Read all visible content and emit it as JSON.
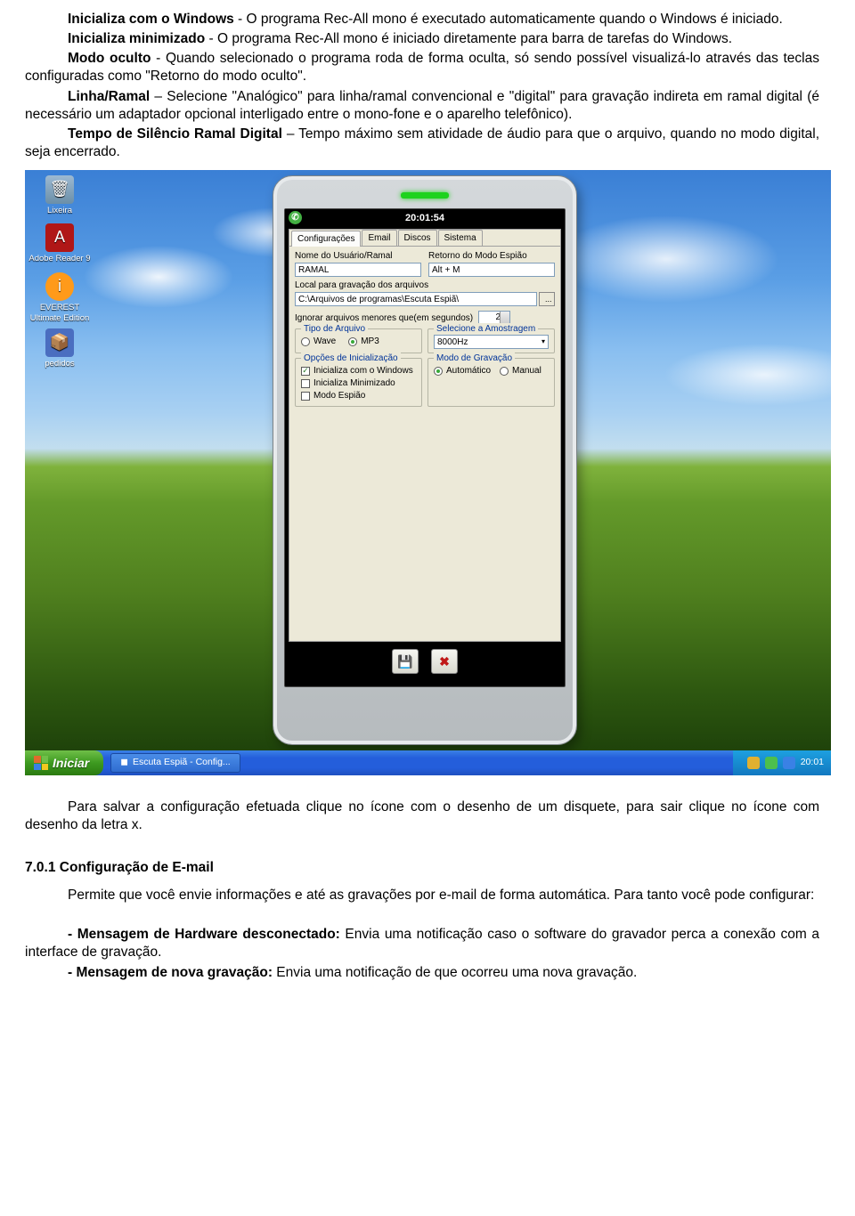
{
  "doc": {
    "p1_lead": "Inicializa com o Windows",
    "p1_rest": " - O programa Rec-All mono é executado automaticamente quando o Windows é iniciado.",
    "p2_lead": "Inicializa minimizado",
    "p2_rest": " - O programa Rec-All mono é iniciado diretamente para barra de tarefas do Windows.",
    "p3_lead": "Modo oculto",
    "p3_rest": " - Quando selecionado o programa roda de forma oculta, só sendo possível visualizá-lo através das teclas configuradas como \"Retorno do modo oculto\".",
    "p4_lead": "Linha/Ramal",
    "p4_rest": " – Selecione \"Analógico\" para linha/ramal convencional e \"digital\" para gravação indireta em ramal digital (é necessário um adaptador opcional interligado entre o mono-fone e o aparelho telefônico).",
    "p5_lead": "Tempo de Silêncio Ramal Digital",
    "p5_rest": " – Tempo máximo sem atividade de áudio para que o arquivo, quando no modo digital, seja encerrado.",
    "after1": "Para salvar a configuração efetuada clique no ícone com o desenho de um disquete, para sair clique no ícone com desenho da letra x.",
    "heading": "7.0.1 Configuração de E-mail",
    "after2": "Permite que você envie informações e até as gravações por e-mail de forma automática. Para tanto você pode configurar:",
    "li1_lead": "- Mensagem de Hardware desconectado:",
    "li1_rest": " Envia uma notificação caso o software do gravador perca a conexão com a interface de gravação.",
    "li2_lead": "- Mensagem de nova gravação:",
    "li2_rest": " Envia uma notificação de que ocorreu uma nova gravação."
  },
  "desktop": {
    "icons": {
      "bin": "Lixeira",
      "adobe": "Adobe Reader 9",
      "everest": "EVEREST Ultimate Edition",
      "pedidos": "pedidos"
    },
    "taskbar": {
      "start": "Iniciar",
      "app": "Escuta Espiã - Config...",
      "clock": "20:01"
    }
  },
  "app": {
    "clock": "20:01:54",
    "tabs": [
      "Configurações",
      "Email",
      "Discos",
      "Sistema"
    ],
    "labels": {
      "user": "Nome do Usuário/Ramal",
      "retorno": "Retorno do Modo Espião",
      "local": "Local para gravação dos arquivos",
      "ignorar": "Ignorar arquivos menores que(em segundos)"
    },
    "values": {
      "user": "RAMAL",
      "retorno": "Alt + M",
      "path": "C:\\Arquivos de programas\\Escuta Espiã\\",
      "ignorar": "2",
      "amostragem": "8000Hz"
    },
    "groups": {
      "tipo_arquivo": "Tipo de Arquivo",
      "amostragem": "Selecione a Amostragem",
      "opcoes": "Opções de Inicialização",
      "modo": "Modo de Gravação"
    },
    "radios": {
      "wave": "Wave",
      "mp3": "MP3",
      "auto": "Automático",
      "manual": "Manual"
    },
    "checks": {
      "c1": "Inicializa com o Windows",
      "c2": "Inicializa Minimizado",
      "c3": "Modo Espião"
    },
    "buttons": {
      "browse": "...",
      "save": "💾",
      "close": "✖"
    }
  }
}
